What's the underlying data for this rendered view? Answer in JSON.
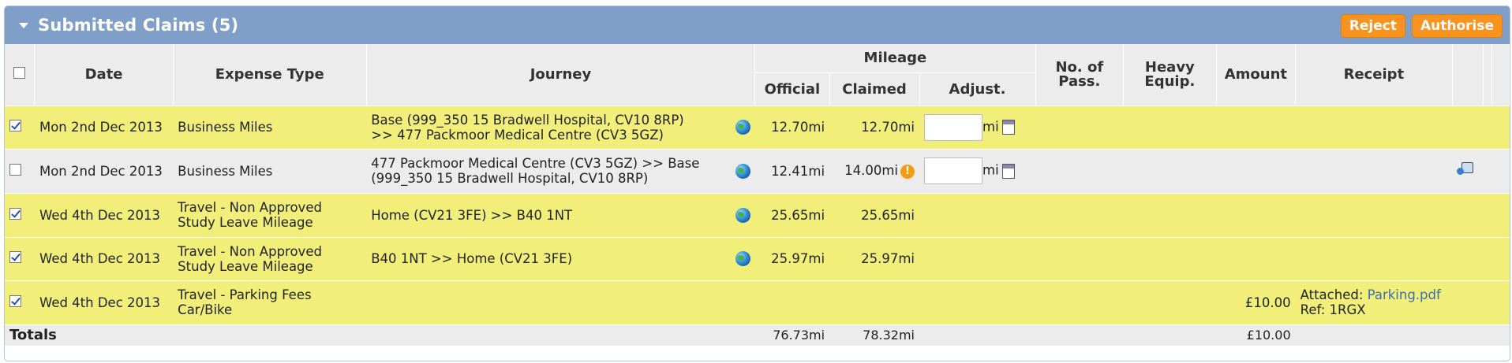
{
  "panel": {
    "title": "Submitted Claims (5)",
    "reject_label": "Reject",
    "authorise_label": "Authorise"
  },
  "headers": {
    "date": "Date",
    "expense_type": "Expense Type",
    "journey": "Journey",
    "mileage": "Mileage",
    "official": "Official",
    "claimed": "Claimed",
    "adjust": "Adjust.",
    "no_of_pass_1": "No. of",
    "no_of_pass_2": "Pass.",
    "heavy_equip_1": "Heavy",
    "heavy_equip_2": "Equip.",
    "amount": "Amount",
    "receipt": "Receipt"
  },
  "rows": [
    {
      "checked": true,
      "date": "Mon 2nd Dec 2013",
      "type_1": "Business Miles",
      "type_2": "",
      "journey_1": "Base (999_350 15 Bradwell Hospital, CV10 8RP)",
      "journey_2": ">> 477 Packmoor Medical Centre (CV3 5GZ)",
      "official": "12.70mi",
      "claimed": "12.70mi",
      "adj_unit": "mi",
      "amount": "",
      "receipt_attached_label": "",
      "receipt_file": "",
      "receipt_ref": ""
    },
    {
      "checked": false,
      "date": "Mon 2nd Dec 2013",
      "type_1": "Business Miles",
      "type_2": "",
      "journey_1": "477 Packmoor Medical Centre (CV3 5GZ) >> Base",
      "journey_2": "(999_350 15 Bradwell Hospital, CV10 8RP)",
      "official": "12.41mi",
      "claimed": "14.00mi",
      "adj_unit": "mi",
      "amount": ""
    },
    {
      "checked": true,
      "date": "Wed 4th Dec 2013",
      "type_1": "Travel - Non Approved",
      "type_2": "Study Leave Mileage",
      "journey_1": "Home (CV21 3FE) >> B40 1NT",
      "journey_2": "",
      "official": "25.65mi",
      "claimed": "25.65mi",
      "amount": ""
    },
    {
      "checked": true,
      "date": "Wed 4th Dec 2013",
      "type_1": "Travel - Non Approved",
      "type_2": "Study Leave Mileage",
      "journey_1": "B40 1NT >> Home (CV21 3FE)",
      "journey_2": "",
      "official": "25.97mi",
      "claimed": "25.97mi",
      "amount": ""
    },
    {
      "checked": true,
      "date": "Wed 4th Dec 2013",
      "type_1": "Travel - Parking Fees",
      "type_2": "Car/Bike",
      "amount": "£10.00",
      "receipt_attached_label": "Attached:",
      "receipt_file": "Parking.pdf",
      "receipt_ref": "Ref: 1RGX"
    }
  ],
  "totals": {
    "label": "Totals",
    "official": "76.73mi",
    "claimed": "78.32mi",
    "amount": "£10.00"
  },
  "icons": {
    "collapse": "triangle-down-icon",
    "map": "globe-icon",
    "calculator": "calculator-icon",
    "warning": "warning-icon",
    "receipt": "receipt-upload-icon"
  },
  "colors": {
    "header_bar": "#7f9fc8",
    "button": "#f7931e",
    "selected_row": "#f1ef7a",
    "unselected_row": "#ececec"
  }
}
